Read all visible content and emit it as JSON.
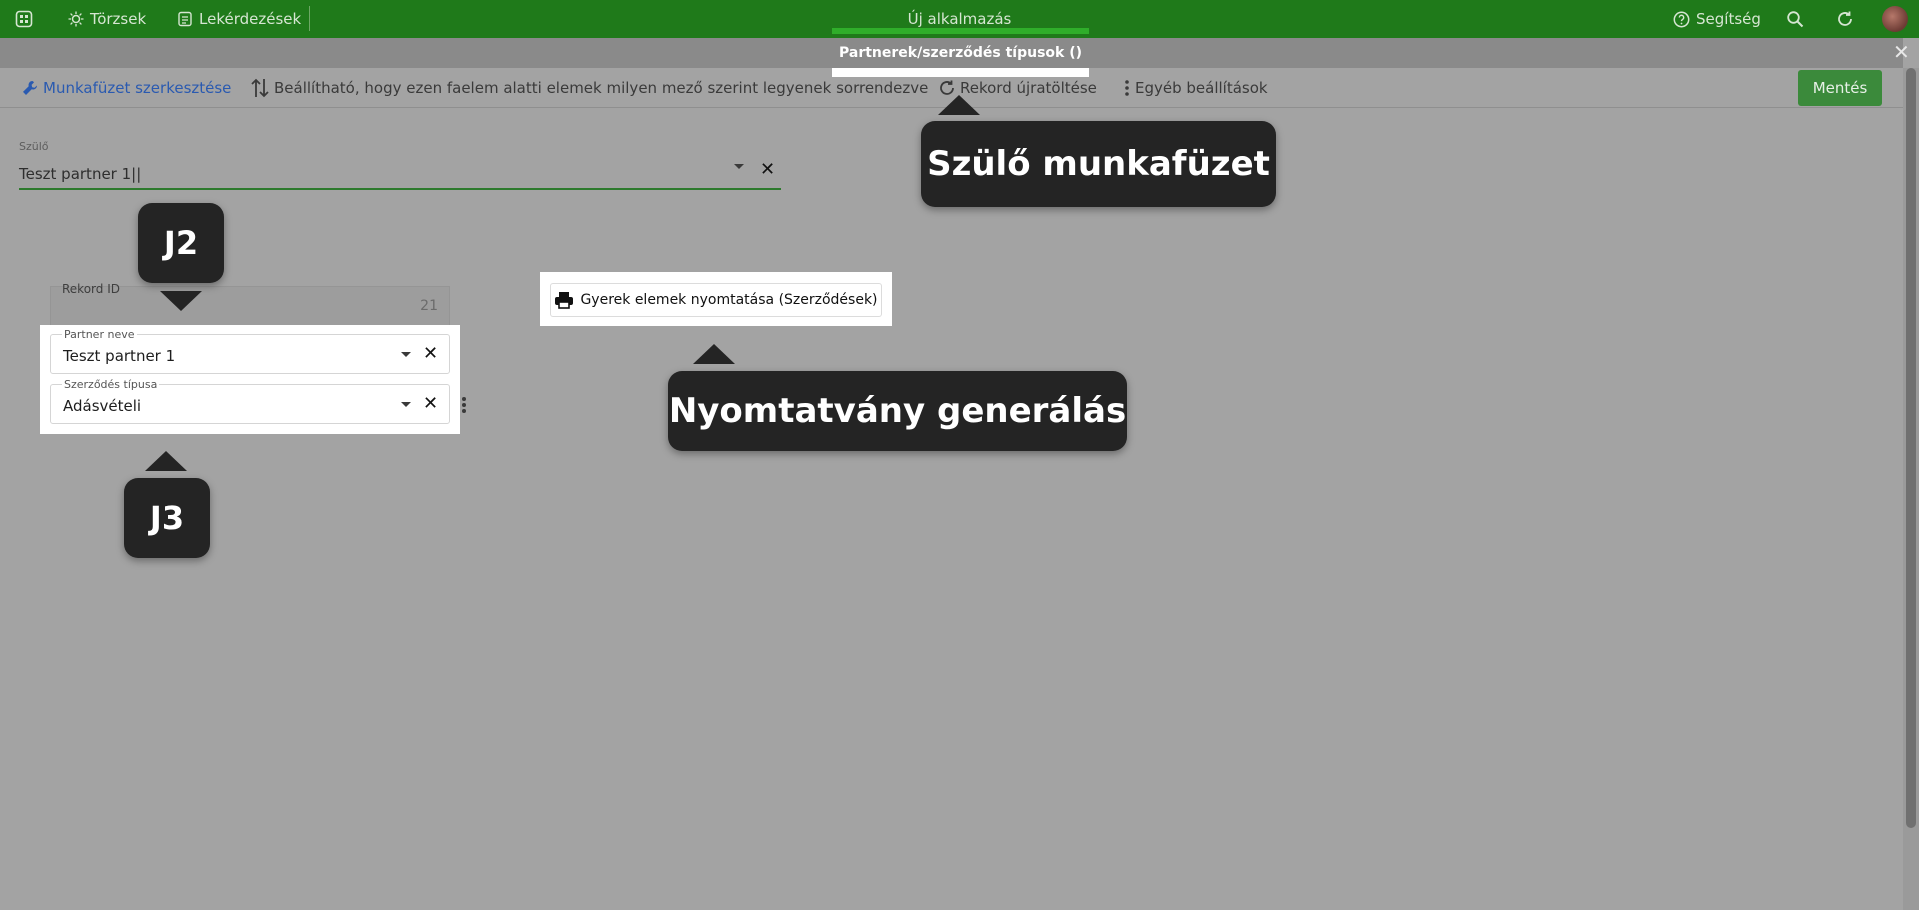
{
  "topbar": {
    "nav_torzsek": "Törzsek",
    "nav_lekerdezesek": "Lekérdezések",
    "app_title": "Új alkalmazás",
    "help": "Segítség"
  },
  "panel": {
    "title": "Partnerek/szerződés típusok ()",
    "close_icon": "close-icon"
  },
  "toolbar": {
    "edit_workbook": "Munkafüzet szerkesztése",
    "sort_setting": "Beállítható, hogy ezen faelem alatti elemek milyen mező szerint legyenek sorrendezve",
    "reload": "Rekord újratöltése",
    "other_settings": "Egyéb beállítások",
    "save": "Mentés"
  },
  "parent_field": {
    "label": "Szülő",
    "value": "Teszt partner 1||"
  },
  "record": {
    "id_label": "Rekord ID",
    "id_value": "21"
  },
  "fields": {
    "partner": {
      "label": "Partner neve",
      "value": "Teszt partner 1"
    },
    "contract_type": {
      "label": "Szerződés típusa",
      "value": "Adásvételi"
    }
  },
  "print_button": "Gyerek elemek nyomtatása (Szerződések)",
  "callouts": {
    "parent_workbook": "Szülő munkafüzet",
    "print_generation": "Nyomtatvány generálás",
    "j2": "J2",
    "j3": "J3"
  },
  "colors": {
    "topbar": "#1f7a1a",
    "accent_link": "#2a5ab0",
    "save_button": "#3b8a3b",
    "callout_bg": "#242424"
  }
}
